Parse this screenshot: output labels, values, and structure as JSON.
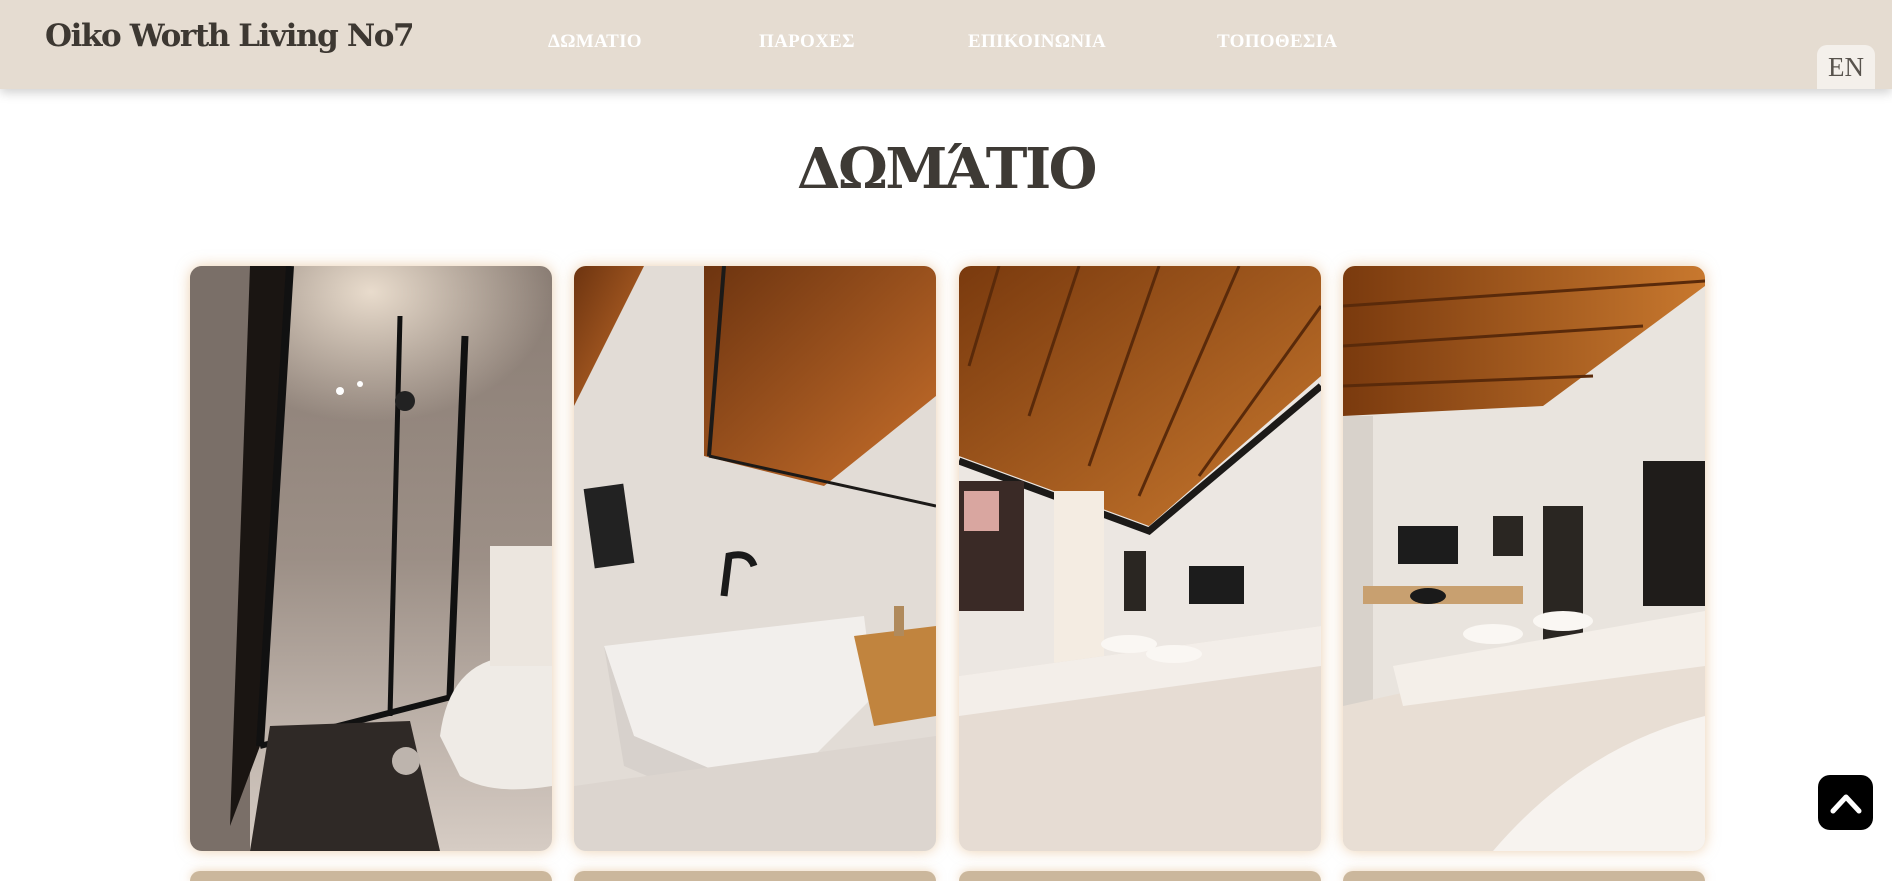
{
  "header": {
    "brand": "Oiko Worth Living No7",
    "nav": [
      {
        "label": "ΔΩΜΑΤΙΟ"
      },
      {
        "label": "ΠΑΡΟΧΕΣ"
      },
      {
        "label": "ΕΠΙΚΟΙΝΩΝΙΑ"
      },
      {
        "label": "ΤΟΠΟΘΕΣΙΑ"
      }
    ],
    "language": "EN"
  },
  "main": {
    "title": "ΔΩΜΆΤΙΟ",
    "gallery": [
      {
        "subject": "shower-bathroom"
      },
      {
        "subject": "vessel-sink"
      },
      {
        "subject": "bedroom-wood-ceiling"
      },
      {
        "subject": "bedroom-tv-desk"
      }
    ]
  },
  "icons": {
    "back_to_top": "chevron-up-icon"
  },
  "colors": {
    "header_bg": "#e5dcd1",
    "title": "#3e3a35",
    "wood": "#a4521a"
  }
}
